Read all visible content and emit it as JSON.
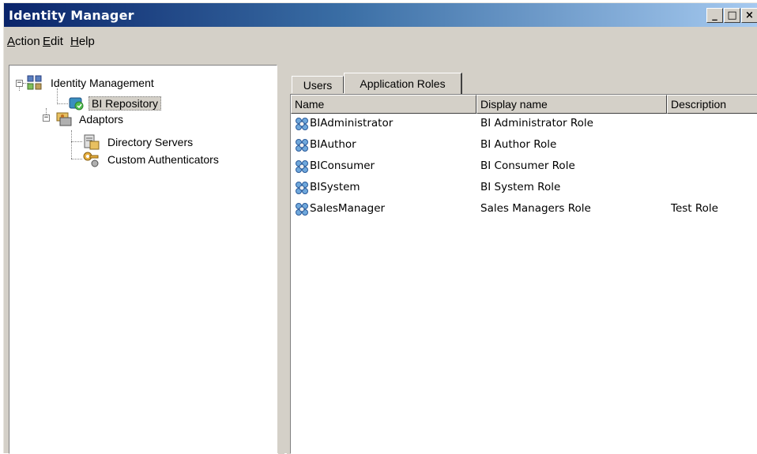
{
  "window": {
    "title": "Identity Manager",
    "controls": [
      "_",
      "□",
      "×"
    ]
  },
  "menu": [
    {
      "label": "Action",
      "underline": "A",
      "rest": "ction"
    },
    {
      "label": "Edit",
      "underline": "E",
      "rest": "dit"
    },
    {
      "label": "Help",
      "underline": "H",
      "rest": "elp"
    }
  ],
  "tree": {
    "root": "Identity Management",
    "repository": "BI Repository",
    "adaptors": "Adaptors",
    "directory_servers": "Directory Servers",
    "custom_authenticators": "Custom Authenticators"
  },
  "tabs": {
    "users": "Users",
    "application_roles": "Application Roles"
  },
  "columns": {
    "name": "Name",
    "display_name": "Display name",
    "description": "Description"
  },
  "roles": [
    {
      "name": "BIAdministrator",
      "display": "BI Administrator Role",
      "description": ""
    },
    {
      "name": "BIAuthor",
      "display": "BI Author Role",
      "description": ""
    },
    {
      "name": "BIConsumer",
      "display": "BI Consumer Role",
      "description": ""
    },
    {
      "name": "BISystem",
      "display": "BI System Role",
      "description": ""
    },
    {
      "name": "SalesManager",
      "display": "Sales Managers Role",
      "description": "Test Role"
    }
  ],
  "colors": {
    "titlebar_start": "#0a246a",
    "titlebar_end": "#a6caf0",
    "chrome": "#d4d0c8"
  }
}
